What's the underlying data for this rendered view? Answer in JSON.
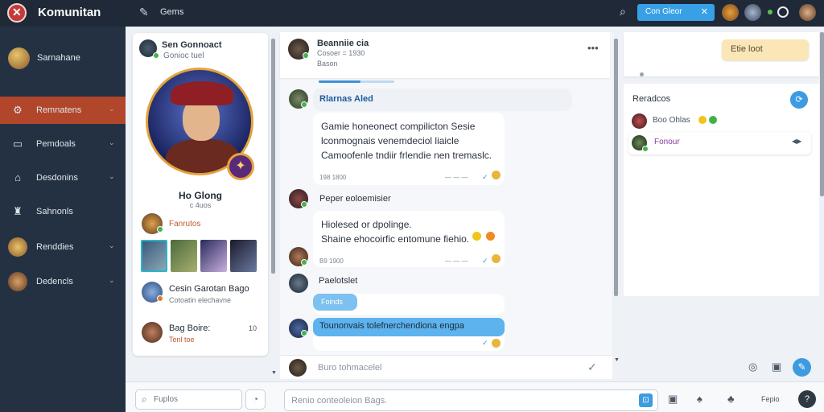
{
  "app": {
    "title": "Komunitan",
    "tab": "Gems"
  },
  "top": {
    "button_label": "Con Gleor"
  },
  "sidebar": {
    "user_name": "Sarnahane",
    "items": [
      {
        "label": "Remnatens",
        "icon": "community-icon",
        "active": true
      },
      {
        "label": "Pemdoals",
        "icon": "tv-icon",
        "active": false
      },
      {
        "label": "Desdonins",
        "icon": "controller-icon",
        "active": false
      },
      {
        "label": "Sahnonls",
        "icon": "castle-icon",
        "active": false
      },
      {
        "label": "Renddies",
        "icon": "friend-avatar-icon",
        "active": false
      },
      {
        "label": "Dedencls",
        "icon": "character-avatar-icon",
        "active": false
      }
    ]
  },
  "profile": {
    "header_title": "Sen Gonnoact",
    "header_sub": "Gonioc tuel",
    "name": "Ho Glong",
    "sub": "c 4uos",
    "friend_label": "Fanrutos",
    "row1_title": "Cesin Garotan Bago",
    "row1_sub": "Cotoatin elechavne",
    "row2_title": "Bag Boire:",
    "row2_sub": "Tenl toe",
    "row2_count": "10"
  },
  "chat": {
    "header_title": "Beanniie cia",
    "header_sub1": "Cosoer = 1930",
    "header_sub2": "Bason",
    "progress": 0.55,
    "messages": [
      {
        "sender": "Rlarnas Aled",
        "text_lines": [
          "Gamie honeonect compilicton Sesie",
          "lconmognais venemdeciol liaicle",
          "Camoofenle tndiir frlendie nen tremaslc."
        ],
        "time": "198 1800"
      },
      {
        "sender": "Peper eoloemisier",
        "text_lines": [
          "Hiolesed or dpolinge.",
          "Shaine ehocoirfic entomune fiehio."
        ],
        "time": "B9 1900"
      },
      {
        "sender": "Paelotslet",
        "pill": "Foinds",
        "bubble": "Tounonvais tolefnerchendiona engpa"
      }
    ],
    "input_placeholder": "Buro tohmacelel"
  },
  "right": {
    "button_label": "Etie loot",
    "list_header": "Reradcos",
    "items": [
      {
        "label": "Boo Ohlas"
      },
      {
        "label": "Fonour"
      }
    ]
  },
  "bottom": {
    "search_placeholder": "Fuplos",
    "compose_placeholder": "Renio conteoleion Bags.",
    "label": "Fepio"
  }
}
